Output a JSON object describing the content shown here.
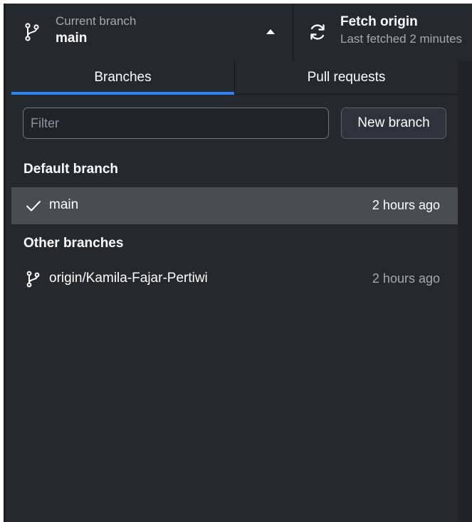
{
  "toolbar": {
    "current_branch_label": "Current branch",
    "current_branch_value": "main",
    "fetch_title": "Fetch origin",
    "fetch_subtitle": "Last fetched 2 minutes"
  },
  "tabs": [
    {
      "label": "Branches",
      "active": true
    },
    {
      "label": "Pull requests",
      "active": false
    }
  ],
  "filter": {
    "placeholder": "Filter",
    "value": ""
  },
  "new_branch_label": "New branch",
  "sections": {
    "default_header": "Default branch",
    "other_header": "Other branches"
  },
  "default_branches": [
    {
      "name": "main",
      "time": "2 hours ago",
      "selected": true
    }
  ],
  "other_branches": [
    {
      "name": "origin/Kamila-Fajar-Pertiwi",
      "time": "2 hours ago",
      "selected": false
    }
  ],
  "colors": {
    "background": "#24292e",
    "selected_row": "#484d54",
    "accent_underline": "#2f81f7"
  },
  "icons": {
    "branch": "git-branch-icon",
    "caret": "caret-up-icon",
    "sync": "sync-icon",
    "check": "check-icon"
  }
}
